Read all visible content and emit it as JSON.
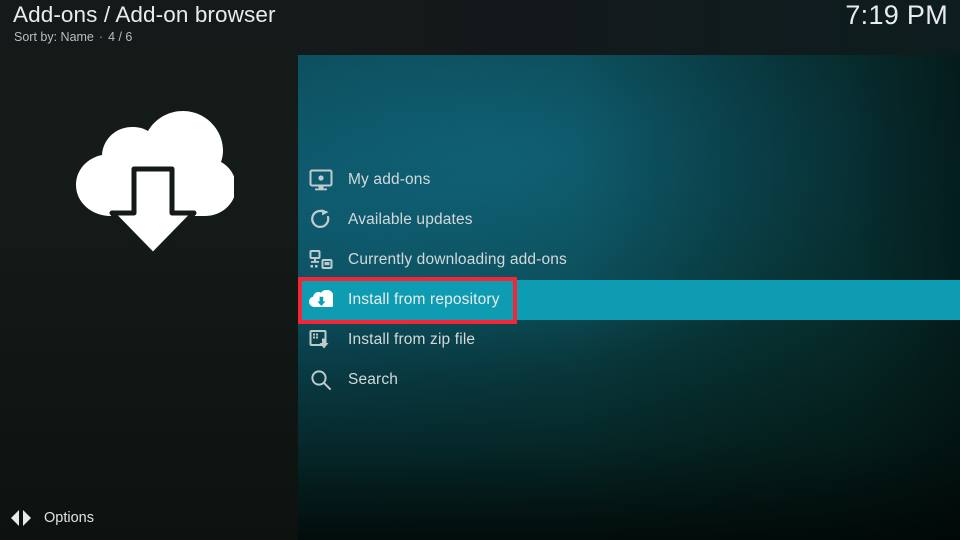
{
  "header": {
    "title": "Add-ons / Add-on browser",
    "sort_label": "Sort by: Name",
    "separator": "·",
    "count": "4 / 6",
    "clock": "7:19 PM"
  },
  "sidebar": {
    "artwork_icon": "cloud-download-icon",
    "options_label": "Options",
    "options_icon": "left-right-arrows-icon"
  },
  "menu": {
    "items": [
      {
        "label": "My add-ons",
        "icon": "monitor-icon",
        "selected": false
      },
      {
        "label": "Available updates",
        "icon": "refresh-icon",
        "selected": false
      },
      {
        "label": "Currently downloading add-ons",
        "icon": "network-transfer-icon",
        "selected": false
      },
      {
        "label": "Install from repository",
        "icon": "cloud-download-icon",
        "selected": true
      },
      {
        "label": "Install from zip file",
        "icon": "zip-download-icon",
        "selected": false
      },
      {
        "label": "Search",
        "icon": "search-icon",
        "selected": false
      }
    ]
  },
  "annotation": {
    "target_label": "Install from repository",
    "color": "#f42534"
  },
  "colors": {
    "highlight": "#0d9cb2",
    "annotation_red": "#f42534",
    "sidebar_bg": "#131a18",
    "header_bg": "#15191a",
    "text_primary": "#e9ecec",
    "text_secondary": "#b8bebe"
  }
}
